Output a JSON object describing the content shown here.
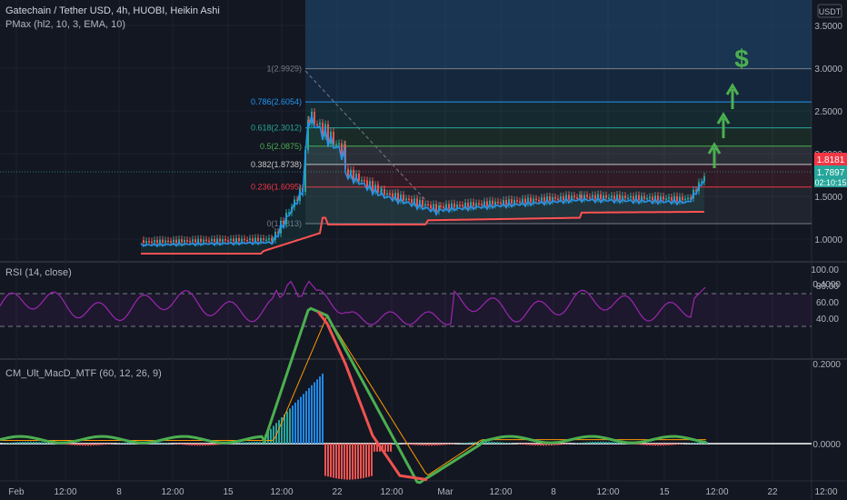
{
  "legend": {
    "symbol": "Gatechain / Tether USD, 4h, HUOBI, Heikin Ashi",
    "indicator": "PMax (hl2, 10, 3, EMA, 10)"
  },
  "currency_badge": "USDT",
  "price_axis": [
    "3.5000",
    "3.0000",
    "2.5000",
    "2.0000",
    "1.5000",
    "1.0000"
  ],
  "price_labels": {
    "alert": "1.8181",
    "last": "1.7897",
    "countdown": "02:10:15"
  },
  "fib": [
    {
      "label": "1(2.9929)",
      "price": 2.9929,
      "color": "#787b86"
    },
    {
      "label": "0.786(2.6054)",
      "price": 2.6054,
      "color": "#2196f3"
    },
    {
      "label": "0.618(2.3012)",
      "price": 2.3012,
      "color": "#26a69a"
    },
    {
      "label": "0.5(2.0875)",
      "price": 2.0875,
      "color": "#4caf50"
    },
    {
      "label": "0.382(1.8738)",
      "price": 1.8738,
      "color": "#c8c8c8"
    },
    {
      "label": "0.236(1.6095)",
      "price": 1.6095,
      "color": "#f23645"
    },
    {
      "label": "0(1.1813)",
      "price": 1.1813,
      "color": "#787b86"
    }
  ],
  "annotations": {
    "dollar": "$"
  },
  "rsi": {
    "title": "RSI (14, close)",
    "axis": [
      "100.00",
      "80.00",
      "60.00",
      "40.00"
    ]
  },
  "macd": {
    "title": "CM_Ult_MacD_MTF (60, 12, 26, 9)",
    "axis": [
      "0.4000",
      "0.2000",
      "0.0000"
    ]
  },
  "time_axis": [
    "Feb",
    "12:00",
    "8",
    "12:00",
    "15",
    "12:00",
    "22",
    "12:00",
    "Mar",
    "12:00",
    "8",
    "12:00",
    "15",
    "12:00",
    "22",
    "12:00"
  ],
  "colors": {
    "bg": "#131722",
    "up": "#26a69a",
    "down": "#ef5350",
    "rsi": "#9c27b0",
    "pmax": "#ff5252",
    "arrow": "#4caf50"
  }
}
